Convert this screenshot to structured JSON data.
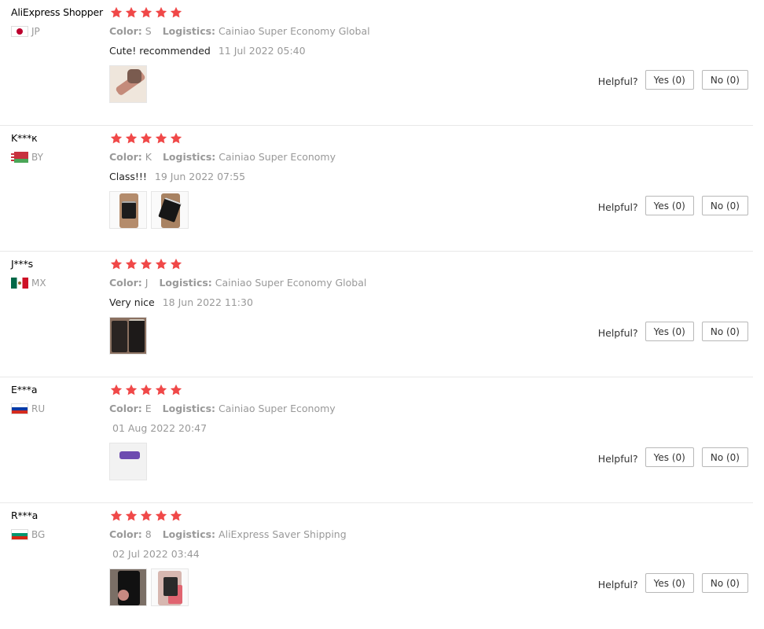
{
  "labels": {
    "color": "Color:",
    "logistics": "Logistics:",
    "helpful": "Helpful?"
  },
  "star_color": "#f04848",
  "reviews": [
    {
      "user": "AliExpress Shopper",
      "country": "JP",
      "flag": "jp",
      "rating": 5,
      "color": "S",
      "logistics": "Cainiao Super Economy Global",
      "text": "Cute! recommended",
      "date": "11 Jul 2022 05:40",
      "photos": [
        "watch-strap-photo"
      ],
      "yes": "Yes (0)",
      "no": "No (0)"
    },
    {
      "user": "K***к",
      "country": "BY",
      "flag": "by",
      "rating": 5,
      "color": "K",
      "logistics": "Cainiao Super Economy",
      "text": "Class!!!",
      "date": "19 Jun 2022 07:55",
      "photos": [
        "watch-box-photo",
        "watch-box-photo"
      ],
      "yes": "Yes (0)",
      "no": "No (0)"
    },
    {
      "user": "J***s",
      "country": "MX",
      "flag": "mx",
      "rating": 5,
      "color": "J",
      "logistics": "Cainiao Super Economy Global",
      "text": "Very nice",
      "date": "18 Jun 2022 11:30",
      "photos": [
        "watch-box-photo"
      ],
      "yes": "Yes (0)",
      "no": "No (0)"
    },
    {
      "user": "E***a",
      "country": "RU",
      "flag": "ru",
      "rating": 5,
      "color": "E",
      "logistics": "Cainiao Super Economy",
      "text": "",
      "date": "01 Aug 2022 20:47",
      "photos": [
        "watch-on-wrist-photo"
      ],
      "yes": "Yes (0)",
      "no": "No (0)"
    },
    {
      "user": "R***a",
      "country": "BG",
      "flag": "bg",
      "rating": 5,
      "color": "8",
      "logistics": "AliExpress Saver Shipping",
      "text": "",
      "date": "02 Jul 2022 03:44",
      "photos": [
        "watch-box-photo",
        "watch-box-photo"
      ],
      "yes": "Yes (0)",
      "no": "No (0)"
    }
  ]
}
